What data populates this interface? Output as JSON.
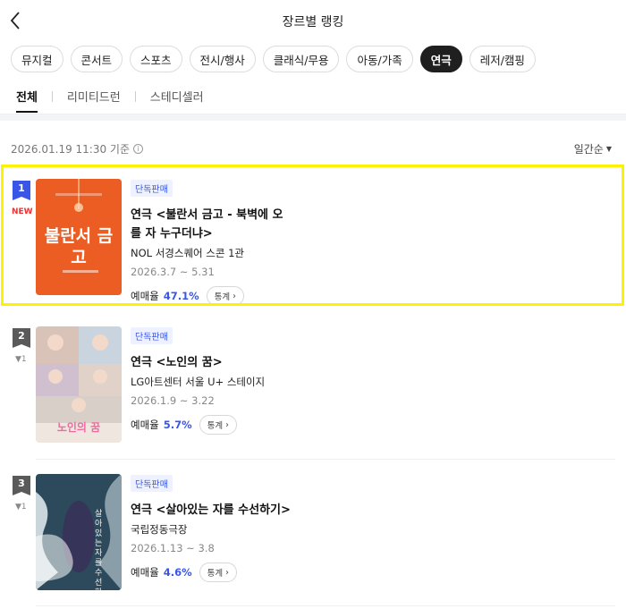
{
  "header": {
    "title": "장르별 랭킹",
    "back_icon": "chevron-left-icon"
  },
  "genres": [
    {
      "label": "뮤지컬",
      "active": false
    },
    {
      "label": "콘서트",
      "active": false
    },
    {
      "label": "스포츠",
      "active": false
    },
    {
      "label": "전시/행사",
      "active": false
    },
    {
      "label": "클래식/무용",
      "active": false
    },
    {
      "label": "아동/가족",
      "active": false
    },
    {
      "label": "연극",
      "active": true
    },
    {
      "label": "레저/캠핑",
      "active": false
    }
  ],
  "subtabs": [
    {
      "label": "전체",
      "active": true
    },
    {
      "label": "리미티드런",
      "active": false
    },
    {
      "label": "스테디셀러",
      "active": false
    }
  ],
  "meta": {
    "timestamp": "2026.01.19 11:30 기준",
    "info_icon": "info-icon",
    "sort_label": "일간순"
  },
  "items": [
    {
      "rank": "1",
      "badge": "NEW",
      "change": "",
      "tag": "단독판매",
      "title_line1": "연극 <불란서 금고 - 북벽에 오",
      "title_line2": "를 자 누구더냐>",
      "venue": "NOL 서경스퀘어 스콘 1관",
      "dates": "2026.3.7 ~ 5.31",
      "rate_label": "예매율",
      "rate": "47.1%",
      "stats_label": "통계",
      "poster_text": "불란서 금고",
      "highlighted": true
    },
    {
      "rank": "2",
      "badge": "",
      "change": "▼1",
      "tag": "단독판매",
      "title_line1": "연극 <노인의 꿈>",
      "title_line2": "",
      "venue": "LG아트센터 서울 U+ 스테이지",
      "dates": "2026.1.9 ~ 3.22",
      "rate_label": "예매율",
      "rate": "5.7%",
      "stats_label": "통계",
      "poster_text": "노인의 꿈",
      "highlighted": false
    },
    {
      "rank": "3",
      "badge": "",
      "change": "▼1",
      "tag": "단독판매",
      "title_line1": "연극 <살아있는 자를 수선하기>",
      "title_line2": "",
      "venue": "국립정동극장",
      "dates": "2026.1.13 ~ 3.8",
      "rate_label": "예매율",
      "rate": "4.6%",
      "stats_label": "통계",
      "poster_text": "살아있는 자를 수선하기",
      "highlighted": false
    }
  ],
  "colors": {
    "accent": "#3a56e6",
    "highlight": "#fff200",
    "new_badge": "#e33333"
  }
}
